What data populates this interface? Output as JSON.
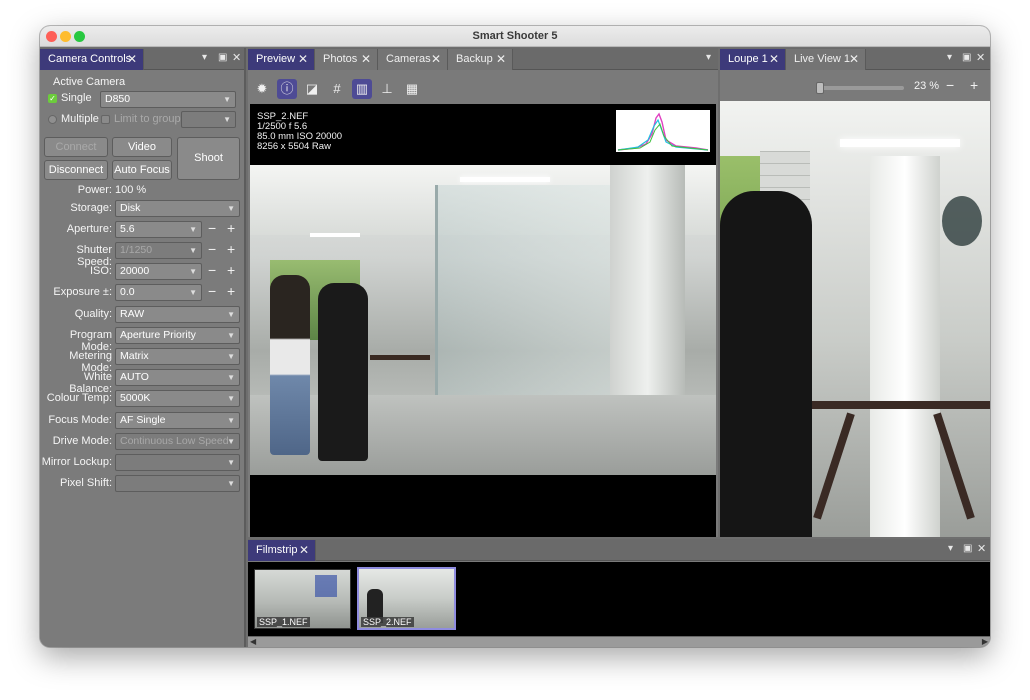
{
  "app": {
    "title": "Smart Shooter 5"
  },
  "camera_controls": {
    "tab_label": "Camera Controls",
    "active_camera_heading": "Active Camera",
    "single_label": "Single",
    "single_camera": "D850",
    "multiple_label": "Multiple",
    "limit_label": "Limit to group:",
    "buttons": {
      "connect": "Connect",
      "video": "Video",
      "disconnect": "Disconnect",
      "auto_focus": "Auto Focus",
      "shoot": "Shoot"
    },
    "power_label": "Power:",
    "power_value": "100 %",
    "settings": [
      {
        "label": "Storage:",
        "value": "Disk"
      },
      {
        "label": "Aperture:",
        "value": "5.6"
      },
      {
        "label": "Shutter Speed:",
        "value": "1/1250"
      },
      {
        "label": "ISO:",
        "value": "20000"
      },
      {
        "label": "Exposure ±:",
        "value": "0.0"
      },
      {
        "label": "Quality:",
        "value": "RAW"
      },
      {
        "label": "Program Mode:",
        "value": "Aperture Priority"
      },
      {
        "label": "Metering Mode:",
        "value": "Matrix"
      },
      {
        "label": "White Balance:",
        "value": "AUTO"
      },
      {
        "label": "Colour Temp:",
        "value": "5000K"
      },
      {
        "label": "Focus Mode:",
        "value": "AF Single"
      },
      {
        "label": "Drive Mode:",
        "value": "Continuous Low Speed"
      },
      {
        "label": "Mirror Lockup:",
        "value": ""
      },
      {
        "label": "Pixel Shift:",
        "value": ""
      }
    ]
  },
  "center": {
    "tabs": [
      "Preview",
      "Photos",
      "Cameras",
      "Backup"
    ],
    "toolbar_icons": [
      "gear-icon",
      "info-icon",
      "exposure-icon",
      "grid-icon",
      "histogram-icon",
      "focus-icon",
      "qr-icon"
    ],
    "overlay": {
      "line1": "SSP_2.NEF",
      "line2": "1/2500    f 5.6",
      "line3": "85.0 mm    ISO 20000",
      "line4": "8256 x 5504 Raw"
    }
  },
  "right": {
    "tabs": [
      "Loupe 1",
      "Live View 1"
    ],
    "zoom": "23 %"
  },
  "filmstrip": {
    "tab_label": "Filmstrip",
    "items": [
      {
        "name": "SSP_1.NEF",
        "selected": false
      },
      {
        "name": "SSP_2.NEF",
        "selected": true
      }
    ]
  },
  "colors": {
    "accent": "#3d3a7a",
    "panel": "#7a7a7a",
    "checked": "#6ccc3c"
  }
}
